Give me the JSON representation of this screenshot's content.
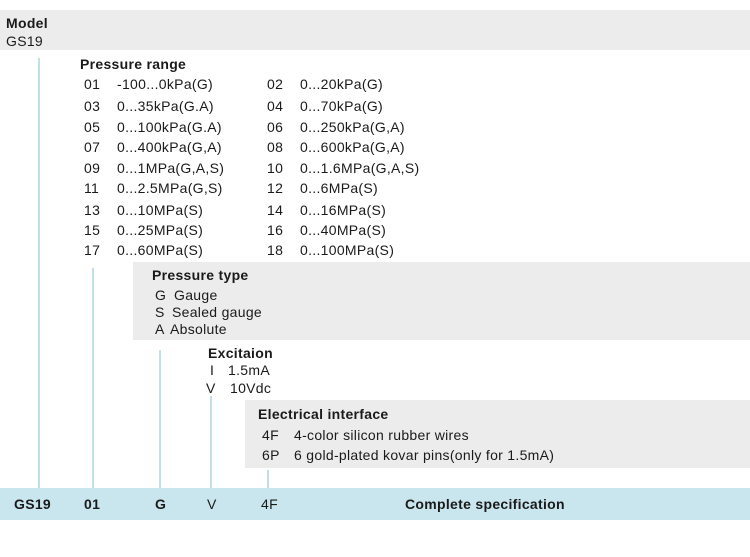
{
  "model": {
    "heading": "Model",
    "value": "GS19"
  },
  "pressure_range": {
    "heading": "Pressure range",
    "rows": [
      {
        "code_a": "01",
        "value_a": "-100...0kPa(G)",
        "code_b": "02",
        "value_b": "0...20kPa(G)"
      },
      {
        "code_a": "03",
        "value_a": "0...35kPa(G.A)",
        "code_b": "04",
        "value_b": "0...70kPa(G)"
      },
      {
        "code_a": "05",
        "value_a": "0...100kPa(G.A)",
        "code_b": "06",
        "value_b": "0...250kPa(G,A)"
      },
      {
        "code_a": "07",
        "value_a": "0...400kPa(G,A)",
        "code_b": "08",
        "value_b": "0...600kPa(G,A)"
      },
      {
        "code_a": "09",
        "value_a": "0...1MPa(G,A,S)",
        "code_b": "10",
        "value_b": "0...1.6MPa(G,A,S)"
      },
      {
        "code_a": "11",
        "value_a": "0...2.5MPa(G,S)",
        "code_b": "12",
        "value_b": "0...6MPa(S)"
      },
      {
        "code_a": "13",
        "value_a": "0...10MPa(S)",
        "code_b": "14",
        "value_b": "0...16MPa(S)"
      },
      {
        "code_a": "15",
        "value_a": "0...25MPa(S)",
        "code_b": "16",
        "value_b": "0...40MPa(S)"
      },
      {
        "code_a": "17",
        "value_a": "0...60MPa(S)",
        "code_b": "18",
        "value_b": "0...100MPa(S)"
      }
    ]
  },
  "pressure_type": {
    "heading": "Pressure type",
    "items": [
      {
        "code": "G",
        "label": "Gauge"
      },
      {
        "code": "S",
        "label": "Sealed gauge"
      },
      {
        "code": "A",
        "label": "Absolute"
      }
    ]
  },
  "excitation": {
    "heading": "Excitaion",
    "items": [
      {
        "code": "I",
        "label": "1.5mA"
      },
      {
        "code": "V",
        "label": "10Vdc"
      }
    ]
  },
  "electrical_interface": {
    "heading": "Electrical interface",
    "items": [
      {
        "code": "4F",
        "label": "4-color silicon rubber wires"
      },
      {
        "code": "6P",
        "label": "6 gold-plated kovar pins(only for 1.5mA)"
      }
    ]
  },
  "specification": {
    "model": "GS19",
    "range": "01",
    "type": "G",
    "excitation": "V",
    "interface": "4F",
    "label": "Complete specification"
  },
  "colors": {
    "panel": "#ececec",
    "line": "#bfe0ea",
    "bar": "#c9e6ef"
  }
}
